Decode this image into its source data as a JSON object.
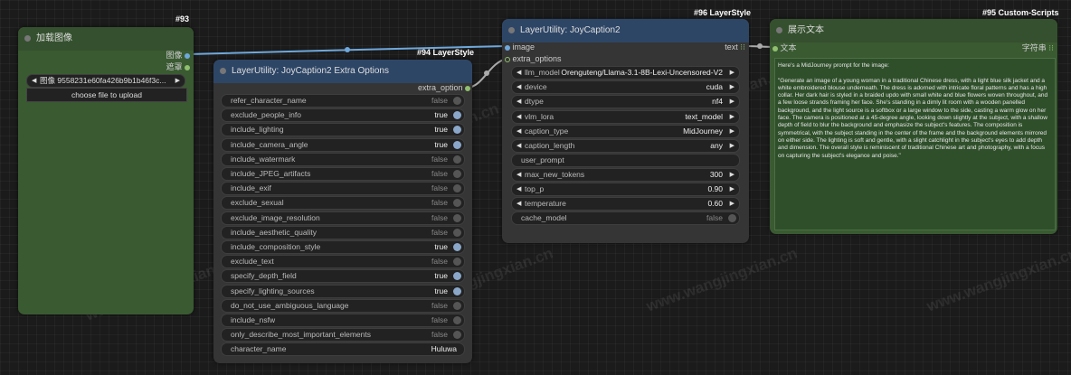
{
  "node93": {
    "id": "#93",
    "title": "加载图像",
    "out_image": "图像",
    "out_mask": "遮罩",
    "image_value": "9558231e60fa426b9b1b46f3c...",
    "image_label": "图像",
    "upload_label": "choose file to upload"
  },
  "node94": {
    "id": "#94 LayerStyle",
    "title": "LayerUtility: JoyCaption2 Extra Options",
    "output": "extra_option",
    "widgets": [
      {
        "label": "refer_character_name",
        "value": "false",
        "on": false
      },
      {
        "label": "exclude_people_info",
        "value": "true",
        "on": true
      },
      {
        "label": "include_lighting",
        "value": "true",
        "on": true
      },
      {
        "label": "include_camera_angle",
        "value": "true",
        "on": true
      },
      {
        "label": "include_watermark",
        "value": "false",
        "on": false
      },
      {
        "label": "include_JPEG_artifacts",
        "value": "false",
        "on": false
      },
      {
        "label": "include_exif",
        "value": "false",
        "on": false
      },
      {
        "label": "exclude_sexual",
        "value": "false",
        "on": false
      },
      {
        "label": "exclude_image_resolution",
        "value": "false",
        "on": false
      },
      {
        "label": "include_aesthetic_quality",
        "value": "false",
        "on": false
      },
      {
        "label": "include_composition_style",
        "value": "true",
        "on": true
      },
      {
        "label": "exclude_text",
        "value": "false",
        "on": false
      },
      {
        "label": "specify_depth_field",
        "value": "true",
        "on": true
      },
      {
        "label": "specify_lighting_sources",
        "value": "true",
        "on": true
      },
      {
        "label": "do_not_use_ambiguous_language",
        "value": "false",
        "on": false
      },
      {
        "label": "include_nsfw",
        "value": "false",
        "on": false
      },
      {
        "label": "only_describe_most_important_elements",
        "value": "false",
        "on": false
      }
    ],
    "character_name_label": "character_name",
    "character_name_value": "Huluwa"
  },
  "node96": {
    "id": "#96 LayerStyle",
    "title": "LayerUtility: JoyCaption2",
    "in_image": "image",
    "in_extra": "extra_options",
    "out_text": "text",
    "combos": [
      {
        "label": "llm_model",
        "value": "Orenguteng/Llama-3.1-8B-Lexi-Uncensored-V2"
      },
      {
        "label": "device",
        "value": "cuda"
      },
      {
        "label": "dtype",
        "value": "nf4"
      },
      {
        "label": "vlm_lora",
        "value": "text_model"
      },
      {
        "label": "caption_type",
        "value": "MidJourney"
      },
      {
        "label": "caption_length",
        "value": "any"
      }
    ],
    "user_prompt_label": "user_prompt",
    "numbers": [
      {
        "label": "max_new_tokens",
        "value": "300"
      },
      {
        "label": "top_p",
        "value": "0.90"
      },
      {
        "label": "temperature",
        "value": "0.60"
      }
    ],
    "cache_label": "cache_model",
    "cache_value": "false"
  },
  "node95": {
    "id": "#95 Custom-Scripts",
    "title": "展示文本",
    "in_text": "文本",
    "out_label": "字符串",
    "content": "Here's a MidJourney prompt for the image:\n\n\"Generate an image of a young woman in a traditional Chinese dress, with a light blue silk jacket and a white embroidered blouse underneath. The dress is adorned with intricate floral patterns and has a high collar. Her dark hair is styled in a braided updo with small white and blue flowers woven throughout, and a few loose strands framing her face. She's standing in a dimly lit room with a wooden panelled background, and the light source is a softbox or a large window to the side, casting a warm glow on her face. The camera is positioned at a 45-degree angle, looking down slightly at the subject, with a shallow depth of field to blur the background and emphasize the subject's features. The composition is symmetrical, with the subject standing in the center of the frame and the background elements mirrored on either side. The lighting is soft and gentle, with a slight catchlight in the subject's eyes to add depth and dimension. The overall style is reminiscent of traditional Chinese art and photography, with a focus on capturing the subject's elegance and poise.\""
  },
  "watermark": "www.wangjingxian.cn",
  "colors": {
    "green_node": "#3a5a32",
    "green_title": "#35502e",
    "dark_node": "#353535",
    "blue_title": "#2e4666",
    "link_blue": "#6fa8dc"
  }
}
